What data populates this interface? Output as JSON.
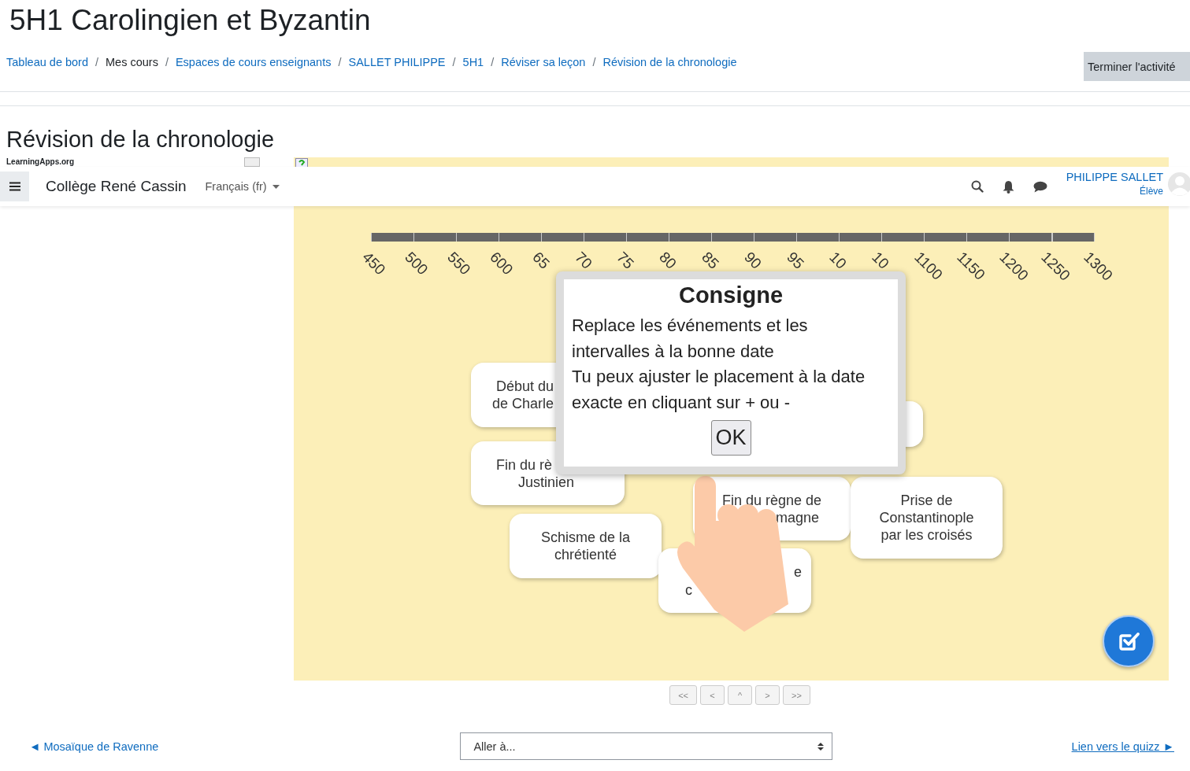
{
  "page_title": "5H1 Carolingien et Byzantin",
  "breadcrumb": {
    "separator": "/",
    "items": [
      {
        "label": "Tableau de bord",
        "link": true
      },
      {
        "label": "Mes cours",
        "link": false
      },
      {
        "label": "Espaces de cours enseignants",
        "link": true
      },
      {
        "label": "SALLET PHILIPPE",
        "link": true
      },
      {
        "label": "5H1",
        "link": true
      },
      {
        "label": "Réviser sa leçon",
        "link": true
      },
      {
        "label": "Révision de la chronologie",
        "link": true
      }
    ]
  },
  "complete_button": "Terminer l'activité",
  "activity_title": "Révision de la chronologie",
  "app_source": "LearningApps.org",
  "navbar": {
    "site_name": "Collège René Cassin",
    "language": "Français (fr)",
    "user_name": "PHILIPPE SALLET",
    "user_role": "Élève"
  },
  "timeline": {
    "labels": [
      "450",
      "500",
      "550",
      "600",
      "65",
      "70",
      "75",
      "80",
      "85",
      "90",
      "95",
      "10",
      "10",
      "1100",
      "1150",
      "1200",
      "1250",
      "1300"
    ]
  },
  "cards": [
    {
      "kind": "text",
      "lines": [
        "Début du",
        "de Charle"
      ]
    },
    {
      "kind": "blank"
    },
    {
      "kind": "text",
      "lines": [
        "Fin du rè",
        "Justinien"
      ]
    },
    {
      "kind": "text",
      "lines": [
        "Fin du règne de",
        "magne"
      ]
    },
    {
      "kind": "text",
      "lines": [
        "Prise de",
        "Constantinople",
        "par les croisés"
      ]
    },
    {
      "kind": "text",
      "lines": [
        "Schisme de la",
        "chrétienté"
      ]
    },
    {
      "kind": "text",
      "lines": [
        "e",
        "c"
      ]
    }
  ],
  "dialog": {
    "title": "Consigne",
    "paragraphs": [
      "Replace les événements et les intervalles à la bonne date",
      "Tu peux ajuster le placement à la date exacte en cliquant sur + ou -"
    ],
    "button": "OK"
  },
  "pager": [
    "<<",
    "<",
    "^",
    ">",
    ">>"
  ],
  "footer": {
    "previous": "◄ Mosaïque de Ravenne",
    "jump": "Aller à...",
    "next": "Lien vers le quizz ►"
  }
}
